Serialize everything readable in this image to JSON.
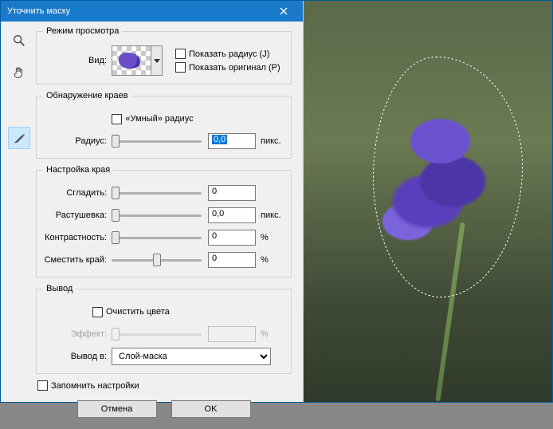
{
  "title": "Уточнить маску",
  "groups": {
    "view": {
      "legend": "Режим просмотра",
      "view_label": "Вид:",
      "show_radius": "Показать радиус (J)",
      "show_original": "Показать оригинал (P)"
    },
    "edge": {
      "legend": "Обнаружение краев",
      "smart_radius": "«Умный» радиус",
      "radius_label": "Радиус:",
      "radius_value": "0,0",
      "radius_unit": "пикс."
    },
    "adjust": {
      "legend": "Настройка края",
      "smooth_label": "Сгладить:",
      "smooth_value": "0",
      "feather_label": "Растушевка:",
      "feather_value": "0,0",
      "feather_unit": "пикс.",
      "contrast_label": "Контрастность:",
      "contrast_value": "0",
      "contrast_unit": "%",
      "shift_label": "Сместить край:",
      "shift_value": "0",
      "shift_unit": "%"
    },
    "output": {
      "legend": "Вывод",
      "decontaminate": "Очистить цвета",
      "amount_label": "Эффект:",
      "amount_unit": "%",
      "output_label": "Вывод в:",
      "output_value": "Слой-маска"
    }
  },
  "remember": "Запомнить настройки",
  "buttons": {
    "cancel": "Отмена",
    "ok": "OK"
  }
}
